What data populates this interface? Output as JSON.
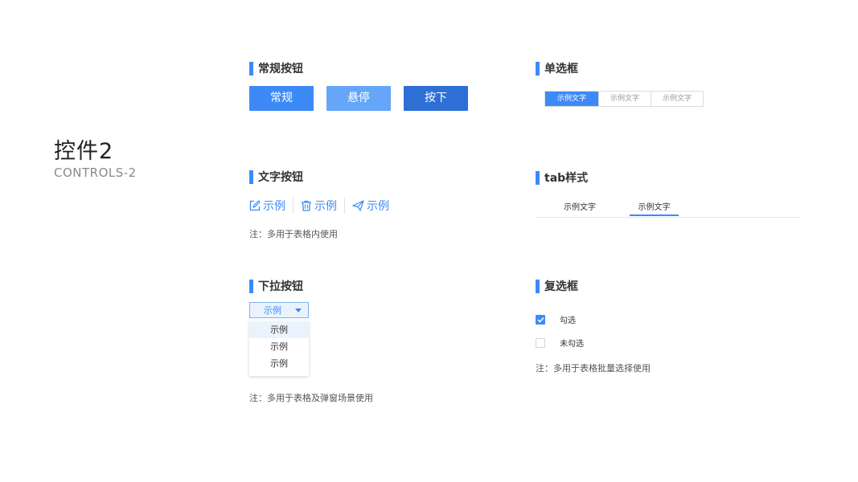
{
  "page": {
    "title": "控件2",
    "subtitle": "CONTROLS-2"
  },
  "colors": {
    "accent": "#3d8af7",
    "accent_hover": "#66a6f8",
    "accent_pressed": "#2e6fd6",
    "dropdown_bg": "#eaf3fd"
  },
  "regular_buttons": {
    "title": "常规按钮",
    "normal_label": "常规",
    "hover_label": "悬停",
    "pressed_label": "按下"
  },
  "text_buttons": {
    "title": "文字按钮",
    "items": [
      {
        "icon": "edit-icon",
        "label": "示例"
      },
      {
        "icon": "trash-icon",
        "label": "示例"
      },
      {
        "icon": "send-icon",
        "label": "示例"
      }
    ],
    "note": "注：多用于表格内使用"
  },
  "dropdown": {
    "title": "下拉按钮",
    "value": "示例",
    "caret_icon": "caret-down-icon",
    "options": [
      "示例",
      "示例",
      "示例"
    ],
    "highlighted_index": 0,
    "note": "注：多用于表格及弹窗场景使用"
  },
  "radio": {
    "title": "单选框",
    "options": [
      "示例文字",
      "示例文字",
      "示例文字"
    ],
    "selected_index": 0
  },
  "tabs": {
    "title": "tab样式",
    "items": [
      "示例文字",
      "示例文字"
    ],
    "active_index": 1
  },
  "checkbox": {
    "title": "复选框",
    "checked_label": "勾选",
    "unchecked_label": "未勾选",
    "note": "注：多用于表格批量选择使用"
  }
}
